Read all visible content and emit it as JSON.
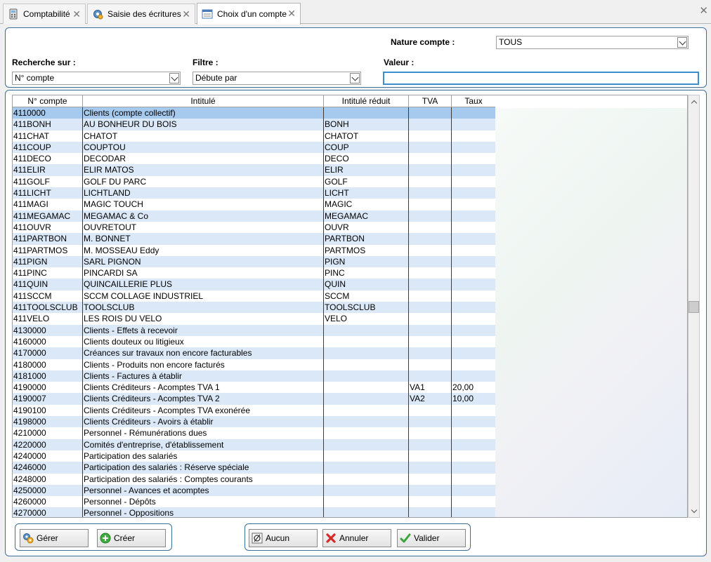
{
  "tabs": [
    {
      "label": "Comptabilité"
    },
    {
      "label": "Saisie des écritures"
    },
    {
      "label": "Choix d'un compte"
    }
  ],
  "search": {
    "nature_label": "Nature compte :",
    "nature_value": "TOUS",
    "recherche_label": "Recherche sur :",
    "recherche_value": "N° compte",
    "filtre_label": "Filtre :",
    "filtre_value": "Débute par",
    "valeur_label": "Valeur :",
    "valeur_value": ""
  },
  "grid": {
    "columns": [
      "N° compte",
      "Intitulé",
      "Intitulé réduit",
      "TVA",
      "Taux"
    ],
    "rows": [
      [
        "4110000",
        "Clients (compte collectif)",
        "",
        "",
        ""
      ],
      [
        "411BONH",
        "AU BONHEUR DU BOIS",
        "BONH",
        "",
        ""
      ],
      [
        "411CHAT",
        "CHATOT",
        "CHATOT",
        "",
        ""
      ],
      [
        "411COUP",
        "COUPTOU",
        "COUP",
        "",
        ""
      ],
      [
        "411DECO",
        "DECODAR",
        "DECO",
        "",
        ""
      ],
      [
        "411ELIR",
        "ELIR MATOS",
        "ELIR",
        "",
        ""
      ],
      [
        "411GOLF",
        "GOLF DU PARC",
        "GOLF",
        "",
        ""
      ],
      [
        "411LICHT",
        "LICHTLAND",
        "LICHT",
        "",
        ""
      ],
      [
        "411MAGI",
        "MAGIC TOUCH",
        "MAGIC",
        "",
        ""
      ],
      [
        "411MEGAMAC",
        "MEGAMAC & Co",
        "MEGAMAC",
        "",
        ""
      ],
      [
        "411OUVR",
        "OUVRETOUT",
        "OUVR",
        "",
        ""
      ],
      [
        "411PARTBON",
        "M. BONNET",
        "PARTBON",
        "",
        ""
      ],
      [
        "411PARTMOS",
        "M. MOSSEAU Eddy",
        "PARTMOS",
        "",
        ""
      ],
      [
        "411PIGN",
        "SARL PIGNON",
        "PIGN",
        "",
        ""
      ],
      [
        "411PINC",
        "PINCARDI SA",
        "PINC",
        "",
        ""
      ],
      [
        "411QUIN",
        "QUINCAILLERIE PLUS",
        "QUIN",
        "",
        ""
      ],
      [
        "411SCCM",
        "SCCM COLLAGE INDUSTRIEL",
        "SCCM",
        "",
        ""
      ],
      [
        "411TOOLSCLUB",
        "TOOLSCLUB",
        "TOOLSCLUB",
        "",
        ""
      ],
      [
        "411VELO",
        "LES ROIS DU VELO",
        "VELO",
        "",
        ""
      ],
      [
        "4130000",
        "Clients - Effets à recevoir",
        "",
        "",
        ""
      ],
      [
        "4160000",
        "Clients douteux ou litigieux",
        "",
        "",
        ""
      ],
      [
        "4170000",
        "Créances sur travaux non encore facturables",
        "",
        "",
        ""
      ],
      [
        "4180000",
        "Clients - Produits non encore facturés",
        "",
        "",
        ""
      ],
      [
        "4181000",
        "Clients - Factures à établir",
        "",
        "",
        ""
      ],
      [
        "4190000",
        "Clients Créditeurs - Acomptes TVA 1",
        "",
        "VA1",
        "20,00"
      ],
      [
        "4190007",
        "Clients Créditeurs - Acomptes TVA 2",
        "",
        "VA2",
        "10,00"
      ],
      [
        "4190100",
        "Clients Créditeurs - Acomptes TVA exonérée",
        "",
        "",
        ""
      ],
      [
        "4198000",
        "Clients Créditeurs - Avoirs à établir",
        "",
        "",
        ""
      ],
      [
        "4210000",
        "Personnel - Rémunérations dues",
        "",
        "",
        ""
      ],
      [
        "4220000",
        "Comités d'entreprise, d'établissement",
        "",
        "",
        ""
      ],
      [
        "4240000",
        "Participation des salariés",
        "",
        "",
        ""
      ],
      [
        "4246000",
        "Participation des salariés : Réserve spéciale",
        "",
        "",
        ""
      ],
      [
        "4248000",
        "Participation des salariés : Comptes courants",
        "",
        "",
        ""
      ],
      [
        "4250000",
        "Personnel - Avances et acomptes",
        "",
        "",
        ""
      ],
      [
        "4260000",
        "Personnel - Dépôts",
        "",
        "",
        ""
      ],
      [
        "4270000",
        "Personnel - Oppositions",
        "",
        "",
        ""
      ]
    ],
    "selected_row": 0
  },
  "buttons": {
    "gerer": "Gérer",
    "creer": "Créer",
    "aucun": "Aucun",
    "annuler": "Annuler",
    "valider": "Valider"
  },
  "colors": {
    "accent": "#3d6f9b",
    "row_alt": "#dbe8f7",
    "row_selected": "#a6c9ee"
  }
}
